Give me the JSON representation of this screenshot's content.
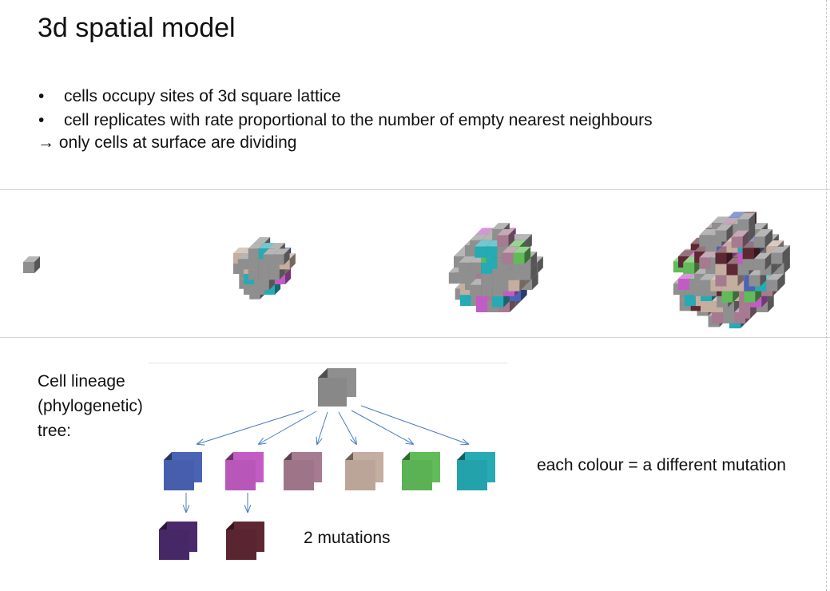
{
  "slide": {
    "title": "3d spatial model",
    "bullets": [
      "cells occupy sites of 3d square lattice",
      "cell replicates with rate proportional to the number of empty nearest neighbours"
    ],
    "bullet_glyph": "•",
    "conclusion": "→ only cells at surface are dividing",
    "lineage_label_lines": [
      "Cell lineage",
      "(phylogenetic)",
      "tree:"
    ],
    "legend_text": "each colour = a different mutation",
    "two_mutations_label": "2 mutations"
  },
  "colors": {
    "grey": "#8f8f8f",
    "blue": "#4a63b5",
    "magenta": "#c25cc4",
    "mauve": "#a67a90",
    "beige": "#c4aea0",
    "green": "#60bb58",
    "teal": "#26aab4",
    "purple": "#4b2a6b",
    "maroon": "#5e2734",
    "arrow": "#4a7dbf"
  },
  "tree": {
    "root": "grey",
    "children": [
      "blue",
      "magenta",
      "mauve",
      "beige",
      "green",
      "teal"
    ],
    "grandchildren": [
      {
        "parent": "blue",
        "color": "purple"
      },
      {
        "parent": "magenta",
        "color": "maroon"
      }
    ]
  },
  "growth_stages": [
    {
      "stage": 1,
      "palette": [
        "grey"
      ]
    },
    {
      "stage": 2,
      "palette": [
        "grey",
        "beige",
        "green",
        "teal",
        "blue",
        "magenta"
      ]
    },
    {
      "stage": 3,
      "palette": [
        "grey",
        "beige",
        "green",
        "teal",
        "blue",
        "magenta",
        "mauve"
      ]
    },
    {
      "stage": 4,
      "palette": [
        "grey",
        "beige",
        "green",
        "teal",
        "blue",
        "magenta",
        "mauve",
        "maroon"
      ]
    }
  ]
}
